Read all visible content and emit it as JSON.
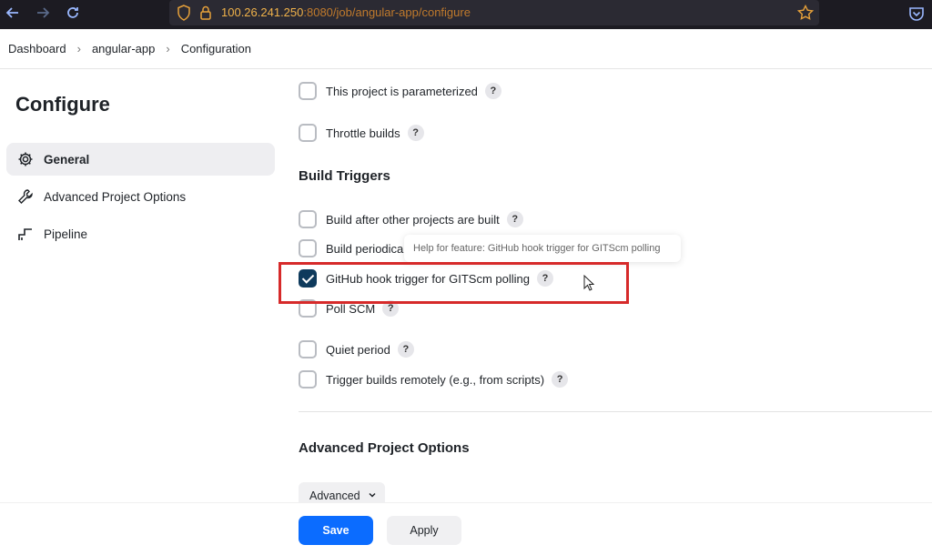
{
  "browser": {
    "url_host": "100.26.241.250",
    "url_rest": ":8080/job/angular-app/configure"
  },
  "breadcrumb": [
    "Dashboard",
    "angular-app",
    "Configuration"
  ],
  "sidebar": {
    "title": "Configure",
    "items": [
      {
        "label": "General",
        "icon": "gear-icon",
        "active": true
      },
      {
        "label": "Advanced Project Options",
        "icon": "wrench-icon",
        "active": false
      },
      {
        "label": "Pipeline",
        "icon": "pipeline-icon",
        "active": false
      }
    ]
  },
  "general_options": [
    {
      "label": "This project is parameterized",
      "checked": false
    },
    {
      "label": "Throttle builds",
      "checked": false
    }
  ],
  "build_triggers": {
    "title": "Build Triggers",
    "items": [
      {
        "label": "Build after other projects are built",
        "checked": false
      },
      {
        "label": "Build periodically",
        "checked": false
      },
      {
        "label": "GitHub hook trigger for GITScm polling",
        "checked": true
      },
      {
        "label": "Poll SCM",
        "checked": false
      },
      {
        "label": "Quiet period",
        "checked": false
      },
      {
        "label": "Trigger builds remotely (e.g., from scripts)",
        "checked": false
      }
    ]
  },
  "tooltip": "Help for feature: GitHub hook trigger for GITScm polling",
  "help_glyph": "?",
  "advanced_section": {
    "title": "Advanced Project Options",
    "button_label": "Advanced"
  },
  "footer": {
    "save_label": "Save",
    "apply_label": "Apply"
  },
  "colors": {
    "primary": "#0b6cff",
    "checked": "#0e3a5c",
    "highlight": "#d62a2a"
  }
}
